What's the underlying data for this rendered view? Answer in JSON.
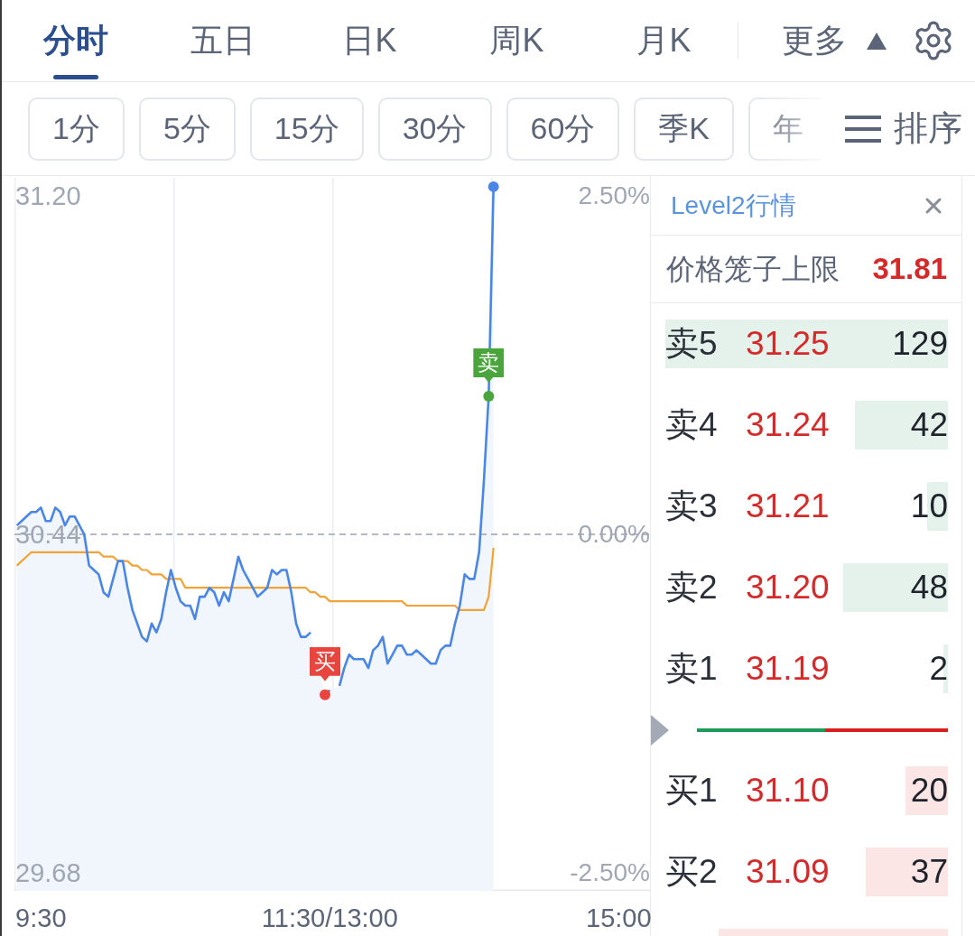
{
  "top_tabs": [
    {
      "label": "分时",
      "selected": true
    },
    {
      "label": "五日",
      "selected": false
    },
    {
      "label": "日K",
      "selected": false
    },
    {
      "label": "周K",
      "selected": false
    },
    {
      "label": "月K",
      "selected": false
    }
  ],
  "more_menu": {
    "label": "更多",
    "expanded": true
  },
  "period_chips": [
    {
      "label": "1分",
      "selected": false
    },
    {
      "label": "5分",
      "selected": false
    },
    {
      "label": "15分",
      "selected": false
    },
    {
      "label": "30分",
      "selected": false
    },
    {
      "label": "60分",
      "selected": false
    },
    {
      "label": "季K",
      "selected": false
    },
    {
      "label": "年",
      "selected": false
    }
  ],
  "sort_button": {
    "label": "排序"
  },
  "chart": {
    "chart_data": {
      "type": "line",
      "categories": [
        null,
        null,
        null,
        null,
        null,
        "9:30",
        null,
        null,
        null,
        null,
        null,
        null,
        null,
        null,
        null,
        null,
        null,
        null,
        null,
        null,
        null,
        null,
        null,
        null,
        null,
        null,
        null,
        null,
        null,
        null,
        null,
        null,
        null,
        null,
        null,
        null,
        null,
        null,
        null,
        null,
        null,
        null,
        null,
        null,
        null,
        null,
        null,
        null,
        null,
        null,
        null,
        null,
        null,
        null,
        null,
        null,
        null,
        null,
        null,
        null,
        null,
        null,
        null,
        null,
        null,
        "11:30/13:00",
        null,
        null,
        null,
        null,
        null,
        null,
        null,
        null,
        null,
        null,
        null,
        null,
        null,
        null,
        null,
        null,
        null,
        null,
        null,
        null,
        null,
        null,
        null,
        null,
        null,
        null,
        null,
        null,
        null,
        null,
        null,
        null,
        null,
        null,
        null,
        null,
        null,
        null,
        null,
        null,
        null,
        null,
        null,
        null,
        null,
        null,
        null,
        null,
        null,
        null,
        null,
        null,
        null,
        null,
        null,
        null,
        null,
        null,
        null,
        "15:00",
        null,
        null,
        null,
        null,
        null,
        null
      ],
      "series": [
        {
          "color": "#4a86e8",
          "values": [
            30.46,
            30.47,
            30.48,
            30.49,
            30.49,
            30.5,
            30.47,
            30.47,
            30.5,
            30.49,
            30.46,
            30.48,
            30.48,
            30.46,
            30.44,
            30.37,
            30.36,
            30.35,
            30.31,
            30.3,
            30.34,
            30.38,
            30.38,
            30.32,
            30.27,
            30.24,
            30.21,
            30.2,
            30.24,
            30.22,
            30.25,
            30.31,
            30.36,
            30.32,
            30.29,
            30.28,
            30.28,
            30.25,
            30.3,
            30.3,
            30.32,
            30.31,
            30.28,
            30.31,
            30.29,
            30.34,
            30.39,
            30.36,
            30.34,
            30.32,
            30.3,
            30.31,
            30.32,
            30.36,
            30.35,
            30.36,
            30.36,
            30.31,
            30.24,
            30.21,
            30.21,
            30.22,
            null,
            null,
            30.08,
            30.09,
            null,
            30.1,
            30.14,
            30.17,
            30.16,
            30.16,
            30.16,
            30.14,
            30.18,
            30.19,
            30.21,
            30.15,
            30.17,
            30.19,
            30.19,
            30.17,
            30.17,
            30.18,
            30.17,
            30.16,
            30.15,
            30.15,
            30.18,
            30.19,
            30.19,
            30.24,
            30.28,
            30.35,
            30.34,
            30.34,
            30.4,
            30.56,
            30.75,
            31.22,
            null,
            null,
            null,
            null,
            null,
            null,
            null,
            null,
            null,
            null,
            null,
            null,
            null,
            null,
            null,
            null,
            null,
            null,
            null,
            null,
            null,
            null,
            null,
            null,
            null,
            null,
            null,
            null,
            null,
            null,
            null,
            null
          ]
        },
        {
          "color": "#f0a437",
          "values": [
            30.37,
            30.38,
            30.39,
            30.4,
            30.4,
            30.4,
            30.4,
            30.4,
            30.4,
            30.4,
            30.4,
            30.4,
            30.4,
            30.4,
            30.4,
            30.4,
            30.4,
            30.4,
            30.39,
            30.39,
            30.39,
            30.38,
            30.38,
            30.38,
            30.37,
            30.37,
            30.36,
            30.36,
            30.35,
            30.35,
            30.35,
            30.34,
            30.34,
            30.34,
            30.34,
            30.32,
            30.32,
            30.32,
            30.32,
            30.32,
            30.32,
            30.32,
            30.32,
            30.32,
            30.32,
            30.32,
            30.32,
            30.32,
            30.32,
            30.32,
            30.32,
            30.32,
            30.32,
            30.32,
            30.32,
            30.32,
            30.32,
            30.32,
            30.32,
            30.32,
            30.32,
            30.31,
            30.31,
            30.3,
            30.3,
            30.29,
            30.29,
            30.29,
            30.29,
            30.29,
            30.29,
            30.29,
            30.29,
            30.29,
            30.29,
            30.29,
            30.29,
            30.29,
            30.29,
            30.29,
            30.29,
            30.28,
            30.28,
            30.28,
            30.28,
            30.28,
            30.28,
            30.28,
            30.28,
            30.28,
            30.28,
            30.28,
            30.27,
            30.27,
            30.27,
            30.27,
            30.27,
            30.27,
            30.3,
            30.41,
            null,
            null,
            null,
            null,
            null,
            null,
            null,
            null,
            null,
            null,
            null,
            null,
            null,
            null,
            null,
            null,
            null,
            null,
            null,
            null,
            null,
            null,
            null,
            null,
            null,
            null,
            null,
            null,
            null,
            null,
            null,
            null
          ]
        }
      ],
      "ylim": [
        29.64,
        31.24
      ],
      "yticks": [
        {
          "value": 31.2,
          "label": "31.20"
        },
        {
          "value": 30.44,
          "label": "30.44"
        },
        {
          "value": 29.68,
          "label": "29.68"
        }
      ],
      "y2lim": [
        -2.63,
        2.63
      ],
      "y2ticks": [
        {
          "value": 2.5,
          "label": "2.50%"
        },
        {
          "value": 0,
          "label": "0.00%"
        },
        {
          "value": -2.5,
          "label": "-2.50%"
        }
      ],
      "ref_lines": [
        {
          "axis": "y",
          "value": 30.44
        }
      ],
      "annotations": [
        {
          "y": 30.08,
          "text": "买"
        },
        {
          "y": 30.75,
          "text": "卖"
        }
      ]
    },
    "signal_markers": [
      {
        "color": "#e8453f"
      },
      {
        "color": "#4aa63c"
      }
    ]
  },
  "level2_panel": {
    "title": "Level2行情",
    "price_cage": {
      "label": "价格笼子上限",
      "value": "31.81"
    },
    "asks": [
      {
        "label": "卖5",
        "price": "31.25",
        "volume": "129",
        "level": 1
      },
      {
        "label": "卖4",
        "price": "31.24",
        "volume": "42",
        "level": 0.33
      },
      {
        "label": "卖3",
        "price": "31.21",
        "volume": "10",
        "level": 0.075
      },
      {
        "label": "卖2",
        "price": "31.20",
        "volume": "48",
        "level": 0.37
      },
      {
        "label": "卖1",
        "price": "31.19",
        "volume": "2",
        "level": 0.015
      }
    ],
    "ratio_bar": {
      "level": 0.51
    },
    "bids": [
      {
        "label": "买1",
        "price": "31.10",
        "volume": "20",
        "level": 0.15
      },
      {
        "label": "买2",
        "price": "31.09",
        "volume": "37",
        "level": 0.29
      },
      {
        "level": 0.81
      }
    ]
  }
}
